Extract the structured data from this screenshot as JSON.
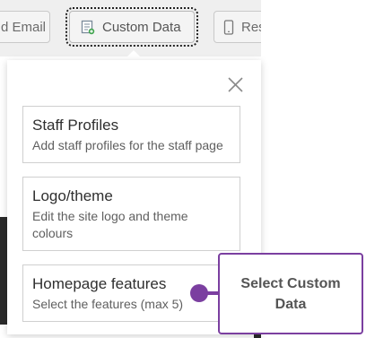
{
  "toolbar": {
    "send_email_label": "d Email",
    "custom_data_label": "Custom Data",
    "res_label": "Res"
  },
  "popover": {
    "close_icon": "close-icon",
    "cards": [
      {
        "title": "Staff Profiles",
        "description": "Add staff profiles for the staff page"
      },
      {
        "title": "Logo/theme",
        "description": "Edit the site logo and theme colours"
      },
      {
        "title": "Homepage features",
        "description": "Select the features (max 5)"
      }
    ]
  },
  "callout": {
    "text": "Select Custom Data"
  },
  "colors": {
    "accent": "#7b3fa0",
    "toolbar_bg": "#efefef",
    "dark_bg": "#2a2a2a"
  }
}
